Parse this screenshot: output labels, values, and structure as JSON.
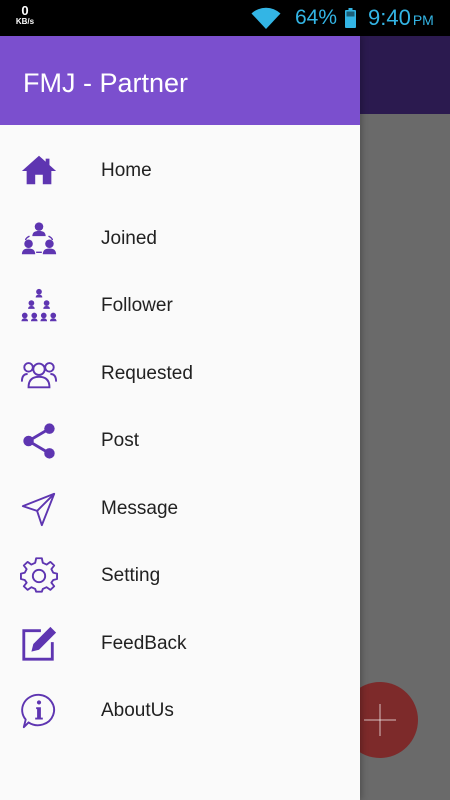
{
  "status_bar": {
    "net_speed_value": "0",
    "net_speed_unit": "KB/s",
    "battery_percent": "64%",
    "time": "9:40",
    "ampm": "PM",
    "time_color": "#33b5e5"
  },
  "drawer": {
    "title": "FMJ - Partner",
    "header_color": "#7b4fce",
    "icon_color": "#5e35b1",
    "items": [
      {
        "label": "Home",
        "icon": "home-icon"
      },
      {
        "label": "Joined",
        "icon": "joined-group-icon"
      },
      {
        "label": "Follower",
        "icon": "follower-tree-icon"
      },
      {
        "label": "Requested",
        "icon": "requested-users-icon"
      },
      {
        "label": "Post",
        "icon": "share-icon"
      },
      {
        "label": "Message",
        "icon": "send-icon"
      },
      {
        "label": "Setting",
        "icon": "gear-icon"
      },
      {
        "label": "FeedBack",
        "icon": "edit-icon"
      },
      {
        "label": "AboutUs",
        "icon": "info-icon"
      }
    ]
  },
  "background": {
    "fab_icon": "plus-icon",
    "fab_color": "#7d2a2a"
  }
}
